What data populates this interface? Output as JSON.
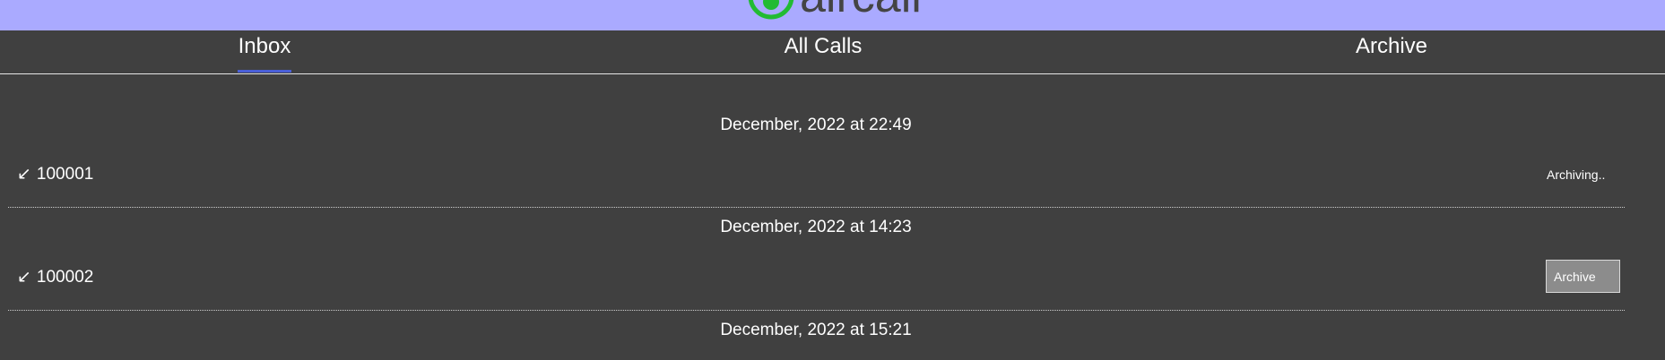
{
  "header": {
    "logo_text": "aircall",
    "brand_color": "#aaaaff",
    "logo_mark_color": "#22bb33"
  },
  "tabs": [
    {
      "label": "Inbox",
      "active": true
    },
    {
      "label": "All Calls",
      "active": false
    },
    {
      "label": "Archive",
      "active": false
    }
  ],
  "calls": [
    {
      "date": "December, 2022 at 22:49",
      "direction_icon": "incoming-arrow-icon",
      "arrow": "↙",
      "number": "100001",
      "status": "Archiving.."
    },
    {
      "date": "December, 2022 at 14:23",
      "direction_icon": "incoming-arrow-icon",
      "arrow": "↙",
      "number": "100002",
      "action_label": "Archive"
    },
    {
      "date": "December, 2022 at 15:21"
    }
  ],
  "colors": {
    "background": "#404040",
    "tab_indicator": "#4a5fd8",
    "archive_button": "#8c8c8c"
  }
}
